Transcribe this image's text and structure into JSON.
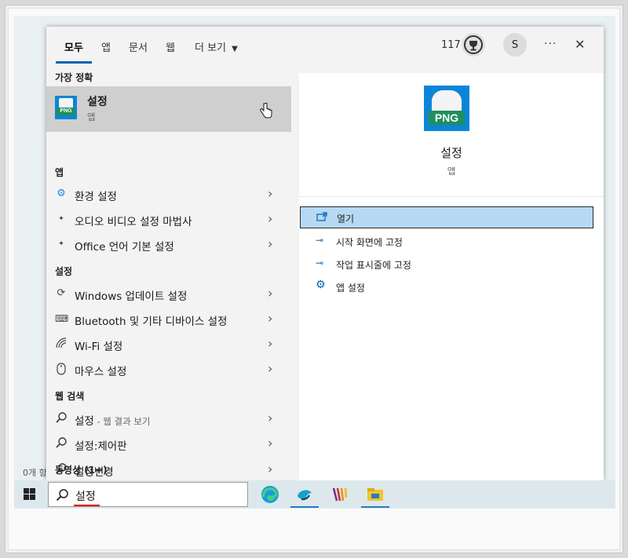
{
  "tabs": [
    {
      "label": "모두"
    },
    {
      "label": "앱"
    },
    {
      "label": "문서"
    },
    {
      "label": "웹"
    },
    {
      "label": "더 보기"
    }
  ],
  "topbar": {
    "points": "117",
    "avatar_letter": "S",
    "more_label": "···",
    "close_label": "✕"
  },
  "best_match": {
    "section": "가장 정확",
    "title": "설정",
    "subtitle": "앱"
  },
  "icon_text": "PNG",
  "apps": {
    "section": "앱",
    "items": [
      {
        "label": "환경 설정"
      },
      {
        "label": "오디오 비디오 설정 마법사"
      },
      {
        "label": "Office 언어 기본 설정"
      }
    ]
  },
  "settings": {
    "section": "설정",
    "items": [
      {
        "label": "Windows 업데이트 설정"
      },
      {
        "label": "Bluetooth 및 기타 디바이스 설정"
      },
      {
        "label": "Wi-Fi 설정"
      },
      {
        "label": "마우스 설정"
      }
    ]
  },
  "web": {
    "section": "웹 검색",
    "items": [
      {
        "label": "설정",
        "suffix": " - 웹 결과 보기"
      },
      {
        "label": "설정:제어판"
      },
      {
        "label": "설정변경"
      }
    ]
  },
  "videos_section": "동영상 (1+)",
  "desktop_status": "0개 항",
  "preview": {
    "title": "설정",
    "subtitle": "앱"
  },
  "actions": [
    {
      "label": "열기"
    },
    {
      "label": "시작 화면에 고정"
    },
    {
      "label": "작업 표시줄에 고정"
    },
    {
      "label": "앱 설정"
    }
  ],
  "search": {
    "value": "설정"
  },
  "colors": {
    "accent": "#0063b1",
    "highlight": "#b7d9f3",
    "selected_row": "#cfcfcf"
  }
}
